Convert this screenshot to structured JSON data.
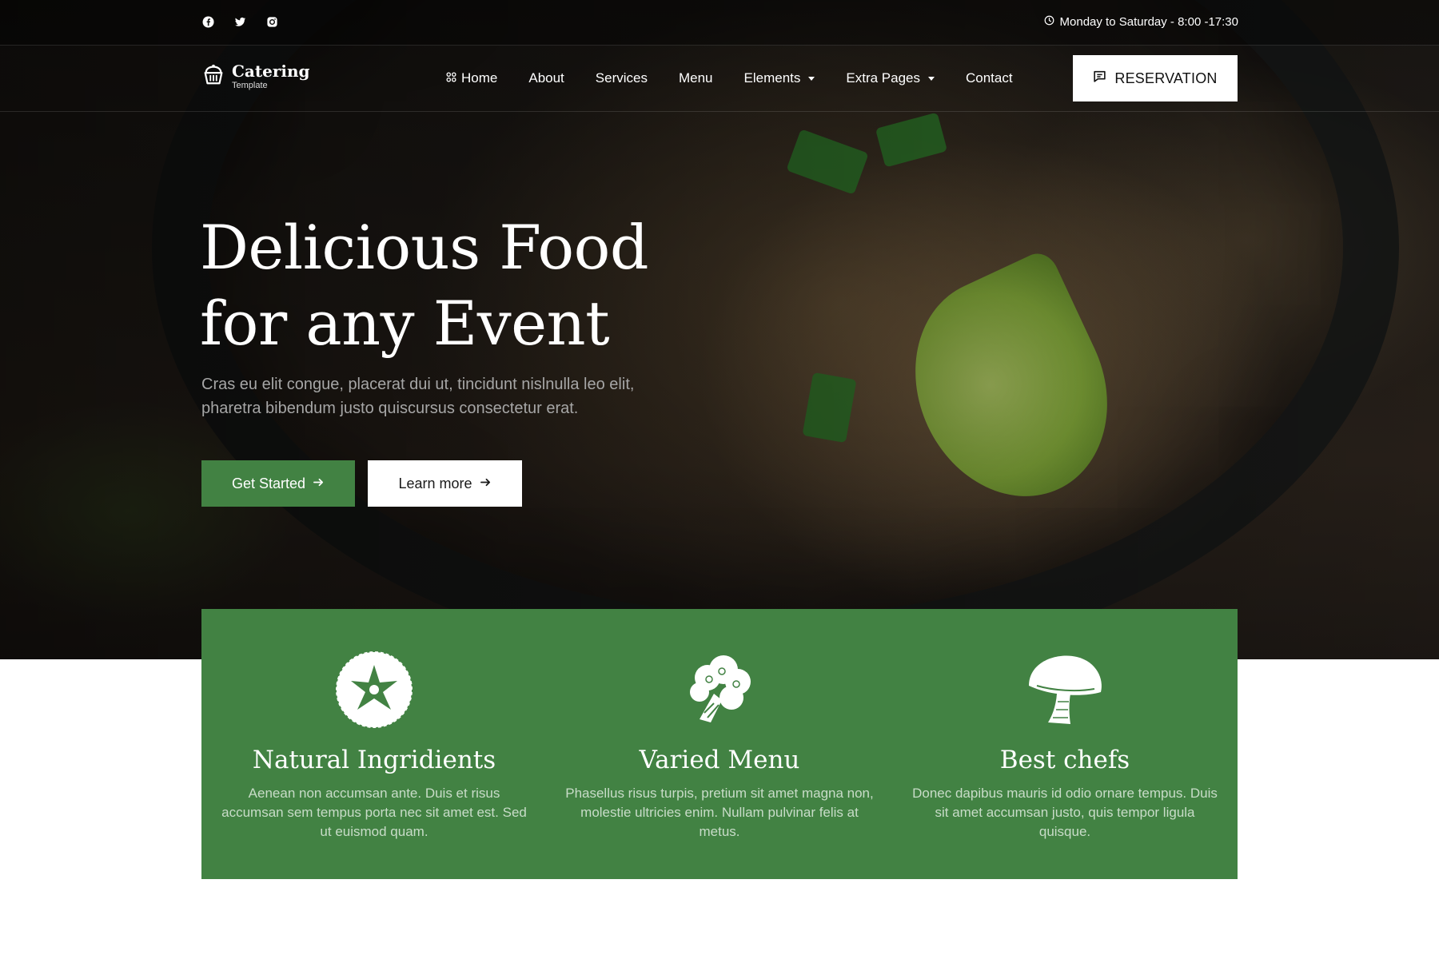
{
  "topbar": {
    "social": [
      "facebook-icon",
      "twitter-icon",
      "instagram-icon"
    ],
    "hours": "Monday to Saturday - 8:00 -17:30"
  },
  "brand": {
    "title": "Catering",
    "subtitle": "Template"
  },
  "nav": {
    "items": [
      {
        "label": "Home"
      },
      {
        "label": "About"
      },
      {
        "label": "Services"
      },
      {
        "label": "Menu"
      },
      {
        "label": "Elements"
      },
      {
        "label": "Extra Pages"
      },
      {
        "label": "Contact"
      }
    ],
    "reservation": "RESERVATION"
  },
  "hero": {
    "title_line1": "Delicious Food",
    "title_line2": "for any Event",
    "text": "Cras eu elit congue, placerat dui ut, tincidunt nislnulla leo elit, pharetra bibendum justo quiscursus consectetur erat.",
    "primary_btn": "Get Started",
    "secondary_btn": "Learn more"
  },
  "features": [
    {
      "title": "Natural Ingridients",
      "text": "Aenean non accumsan ante. Duis et risus accumsan sem tempus porta nec sit amet est. Sed ut euismod quam."
    },
    {
      "title": "Varied Menu",
      "text": "Phasellus risus turpis, pretium sit amet magna non, molestie ultricies enim. Nullam pulvinar felis at metus."
    },
    {
      "title": "Best chefs",
      "text": "Donec dapibus mauris id odio ornare tempus. Duis sit amet accumsan justo, quis tempor ligula quisque."
    }
  ],
  "colors": {
    "accent": "#428243",
    "dark": "#111111",
    "white": "#ffffff"
  }
}
